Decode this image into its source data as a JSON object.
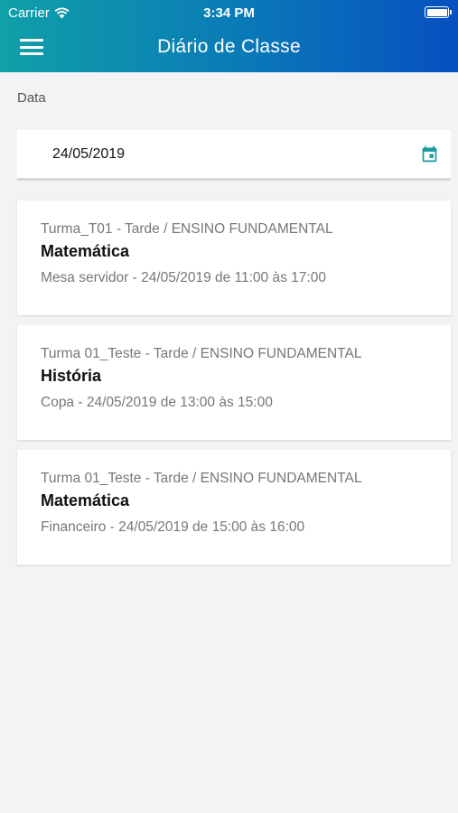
{
  "status_bar": {
    "carrier": "Carrier",
    "time": "3:34 PM",
    "battery_level": 1.0
  },
  "header": {
    "title": "Diário de Classe",
    "menu_icon": "hamburger-menu-icon",
    "gradient": [
      "#10a0a8",
      "#0650c0"
    ]
  },
  "date_filter": {
    "label": "Data",
    "value": "24/05/2019",
    "icon": "calendar-icon",
    "icon_color": "#1a9ba0"
  },
  "classes": [
    {
      "class_info": "Turma_T01 - Tarde / ENSINO FUNDAMENTAL",
      "subject": "Matemática",
      "detail": "Mesa servidor - 24/05/2019 de 11:00 às 17:00"
    },
    {
      "class_info": "Turma 01_Teste - Tarde / ENSINO FUNDAMENTAL",
      "subject": "História",
      "detail": "Copa - 24/05/2019 de 13:00 às 15:00"
    },
    {
      "class_info": "Turma 01_Teste - Tarde / ENSINO FUNDAMENTAL",
      "subject": "Matemática",
      "detail": "Financeiro - 24/05/2019 de 15:00 às 16:00"
    }
  ]
}
